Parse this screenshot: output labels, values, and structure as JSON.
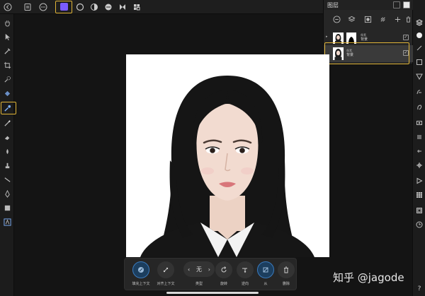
{
  "layers_panel": {
    "title": "图层",
    "layers": [
      {
        "meta": "像素",
        "name": "背景",
        "checked": "✓"
      },
      {
        "meta": "像素",
        "name": "背景",
        "checked": "✓"
      }
    ]
  },
  "context_toolbar": {
    "items": [
      {
        "label": "填充上下文"
      },
      {
        "label": "对齐上下文"
      },
      {
        "label": "类型",
        "value": "无",
        "prev": "‹",
        "next": "›"
      },
      {
        "label": "旋转"
      },
      {
        "label": "逆向"
      },
      {
        "label": "从"
      },
      {
        "label": "删除"
      }
    ]
  },
  "watermark": "知乎 @jagode",
  "bottom_right_help": "?",
  "colors": {
    "highlight": "#e0b437",
    "persona_accent": "#7b5cff",
    "active_blue": "#3a7bbf",
    "canvas_bg": "#ffffff",
    "app_bg": "#141414"
  }
}
